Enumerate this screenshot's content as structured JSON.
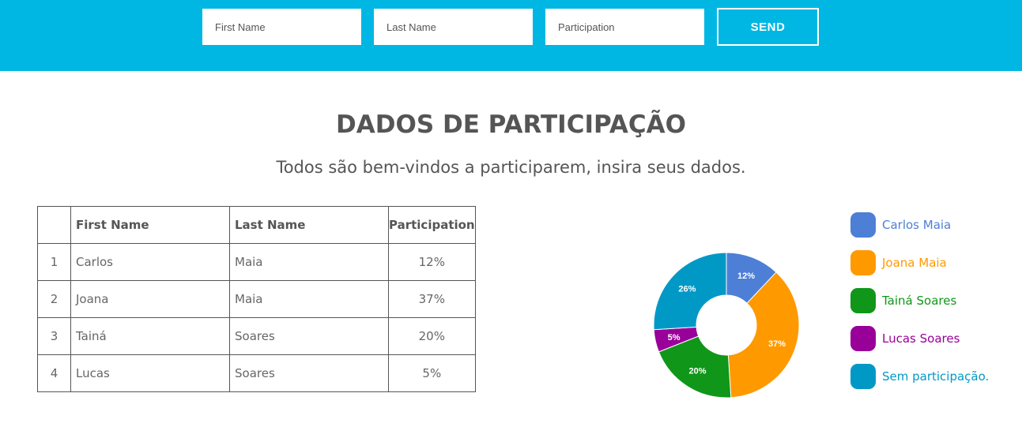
{
  "form": {
    "first_name_placeholder": "First Name",
    "last_name_placeholder": "Last Name",
    "participation_placeholder": "Participation",
    "send_label": "SEND"
  },
  "heading": {
    "title": "DADOS DE PARTICIPAÇÃO",
    "subtitle": "Todos são bem-vindos a participarem, insira seus dados."
  },
  "table": {
    "headers": [
      "",
      "First Name",
      "Last Name",
      "Participation"
    ],
    "rows": [
      {
        "index": "1",
        "first": "Carlos",
        "last": "Maia",
        "participation": "12%"
      },
      {
        "index": "2",
        "first": "Joana",
        "last": "Maia",
        "participation": "37%"
      },
      {
        "index": "3",
        "first": "Tainá",
        "last": "Soares",
        "participation": "20%"
      },
      {
        "index": "4",
        "first": "Lucas",
        "last": "Soares",
        "participation": "5%"
      }
    ]
  },
  "chart_data": {
    "type": "pie",
    "donut": true,
    "title": "",
    "legend_position": "right",
    "categories": [
      "Carlos Maia",
      "Joana Maia",
      "Tainá Soares",
      "Lucas Soares",
      "Sem participação."
    ],
    "values": [
      12,
      37,
      20,
      5,
      26
    ],
    "labels": [
      "12%",
      "37%",
      "20%",
      "5%",
      "26%"
    ],
    "colors": [
      "#4d7fd6",
      "#ff9900",
      "#109618",
      "#990099",
      "#0099c6"
    ]
  },
  "colors": {
    "header_bar": "#00b7e3",
    "text": "#555555"
  }
}
